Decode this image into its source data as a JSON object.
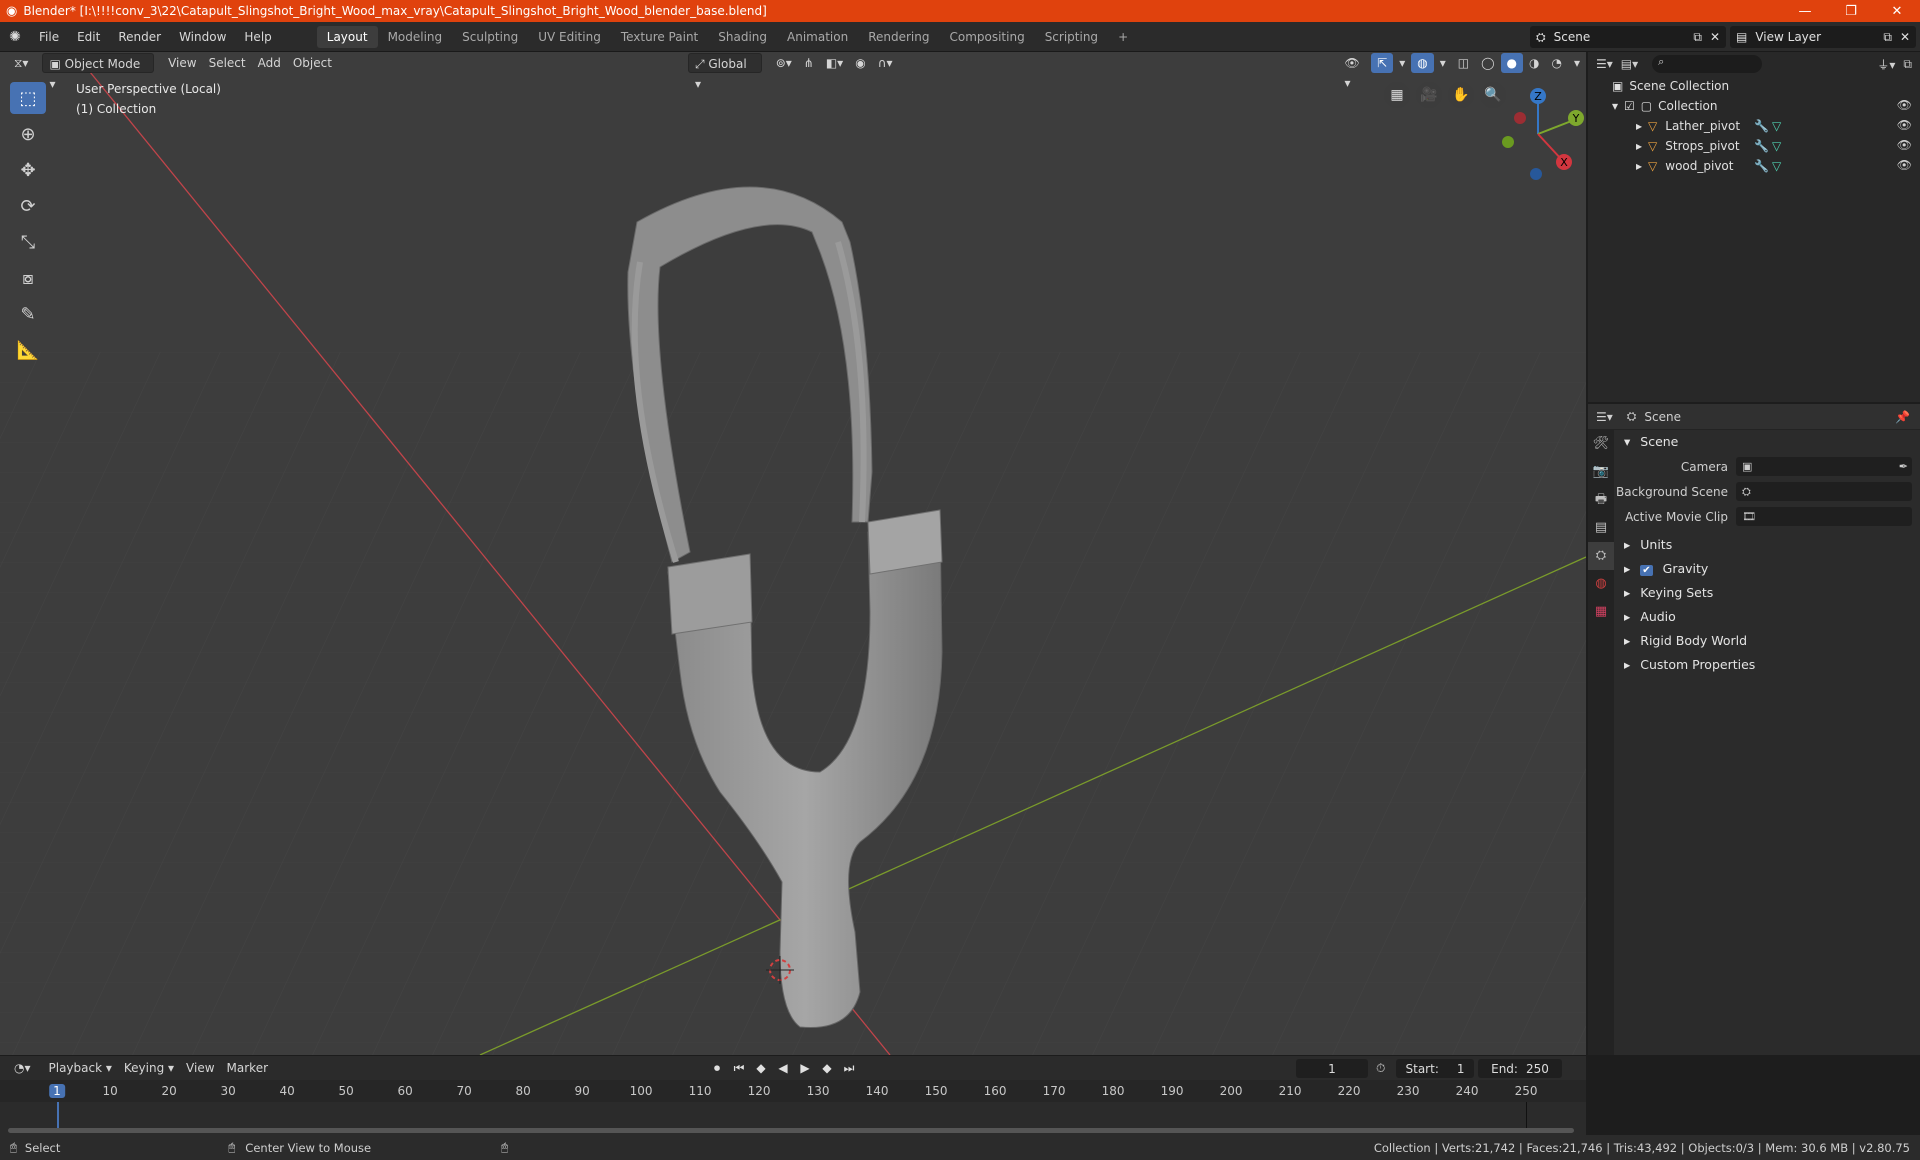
{
  "window": {
    "title": "Blender* [I:\\!!!!conv_3\\22\\Catapult_Slingshot_Bright_Wood_max_vray\\Catapult_Slingshot_Bright_Wood_blender_base.blend]",
    "minimize": "—",
    "maximize": "❐",
    "close": "✕"
  },
  "menus": [
    "File",
    "Edit",
    "Render",
    "Window",
    "Help"
  ],
  "workspaces": [
    "Layout",
    "Modeling",
    "Sculpting",
    "UV Editing",
    "Texture Paint",
    "Shading",
    "Animation",
    "Rendering",
    "Compositing",
    "Scripting"
  ],
  "add_workspace": "+",
  "scene_selector": "Scene",
  "view_layer_selector": "View Layer",
  "viewport": {
    "mode": "Object Mode",
    "menus": [
      "View",
      "Select",
      "Add",
      "Object"
    ],
    "transform_orientation": "Global",
    "overlay_line1": "User Perspective (Local)",
    "overlay_line2": "(1) Collection",
    "gizmo_axes": {
      "z": "Z",
      "y": "Y",
      "x": "X"
    }
  },
  "outliner": {
    "scene_collection": "Scene Collection",
    "collection": "Collection",
    "objects": [
      "Lather_pivot",
      "Strops_pivot",
      "wood_pivot"
    ]
  },
  "properties": {
    "header": "Scene",
    "section_title": "Scene",
    "camera_label": "Camera",
    "background_scene_label": "Background Scene",
    "active_movie_clip_label": "Active Movie Clip",
    "panels": [
      "Units",
      "Gravity",
      "Keying Sets",
      "Audio",
      "Rigid Body World",
      "Custom Properties"
    ]
  },
  "timeline": {
    "menus": [
      "Playback",
      "Keying",
      "View",
      "Marker"
    ],
    "current_frame": "1",
    "start_label": "Start:",
    "start": "1",
    "end_label": "End:",
    "end": "250",
    "ticks": [
      "1",
      "10",
      "20",
      "30",
      "40",
      "50",
      "60",
      "70",
      "80",
      "90",
      "100",
      "110",
      "120",
      "130",
      "140",
      "150",
      "160",
      "170",
      "180",
      "190",
      "200",
      "210",
      "220",
      "230",
      "240",
      "250"
    ]
  },
  "statusbar": {
    "select": "Select",
    "center_view": "Center View to Mouse",
    "stats": "Collection | Verts:21,742 | Faces:21,746 | Tris:43,492 | Objects:0/3 | Mem: 30.6 MB | v2.80.75"
  },
  "colors": {
    "titlebar": "#e0420d",
    "accent": "#4772b3",
    "x_axis": "#d2363f",
    "y_axis": "#7ea82d",
    "z_axis": "#3577c7"
  }
}
